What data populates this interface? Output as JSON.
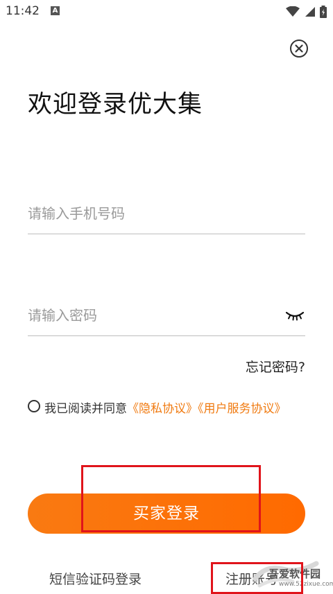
{
  "status_bar": {
    "time": "11:42",
    "notification_icon_letter": "A",
    "icons": [
      "wifi-icon",
      "signal-icon",
      "battery-icon"
    ]
  },
  "close_icon": "close-icon",
  "title": "欢迎登录优大集",
  "phone_field": {
    "placeholder": "请输入手机号码",
    "value": ""
  },
  "password_field": {
    "placeholder": "请输入密码",
    "value": "",
    "visibility_icon": "eye-closed-icon"
  },
  "forgot_password": "忘记密码?",
  "agreement": {
    "checked": false,
    "text": "我已阅读并同意",
    "privacy_link": "《隐私协议》",
    "service_link": "《用户服务协议》"
  },
  "login_button": "买家登录",
  "sms_login": "短信验证码登录",
  "register": "注册账号",
  "watermark": {
    "main": "吾爱软件园",
    "sub": "www.52zixue.com"
  },
  "colors": {
    "accent": "#f97a12",
    "link": "#f07a10",
    "highlight_box": "#e0141b"
  }
}
